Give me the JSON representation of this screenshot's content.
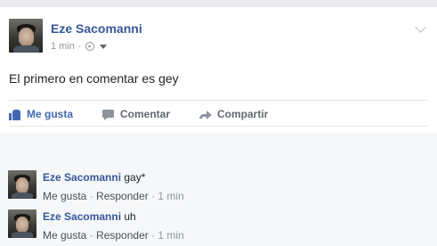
{
  "post": {
    "author": "Eze Sacomanni",
    "time": "1 min",
    "meta_separator": "·",
    "text": "El primero en comentar es gey"
  },
  "actions": {
    "like": "Me gusta",
    "comment": "Comentar",
    "share": "Compartir"
  },
  "comments": [
    {
      "author": "Eze Sacomanni",
      "text": "gay*",
      "like": "Me gusta",
      "reply": "Responder",
      "time": "1 min",
      "separator": " · "
    },
    {
      "author": "Eze Sacomanni",
      "text": "uh",
      "like": "Me gusta",
      "reply": "Responder",
      "time": "1 min",
      "separator": " · "
    }
  ],
  "colors": {
    "link_blue": "#365899",
    "like_blue": "#4267b2",
    "muted": "#90949c",
    "comments_bg": "#f6f7f9"
  }
}
